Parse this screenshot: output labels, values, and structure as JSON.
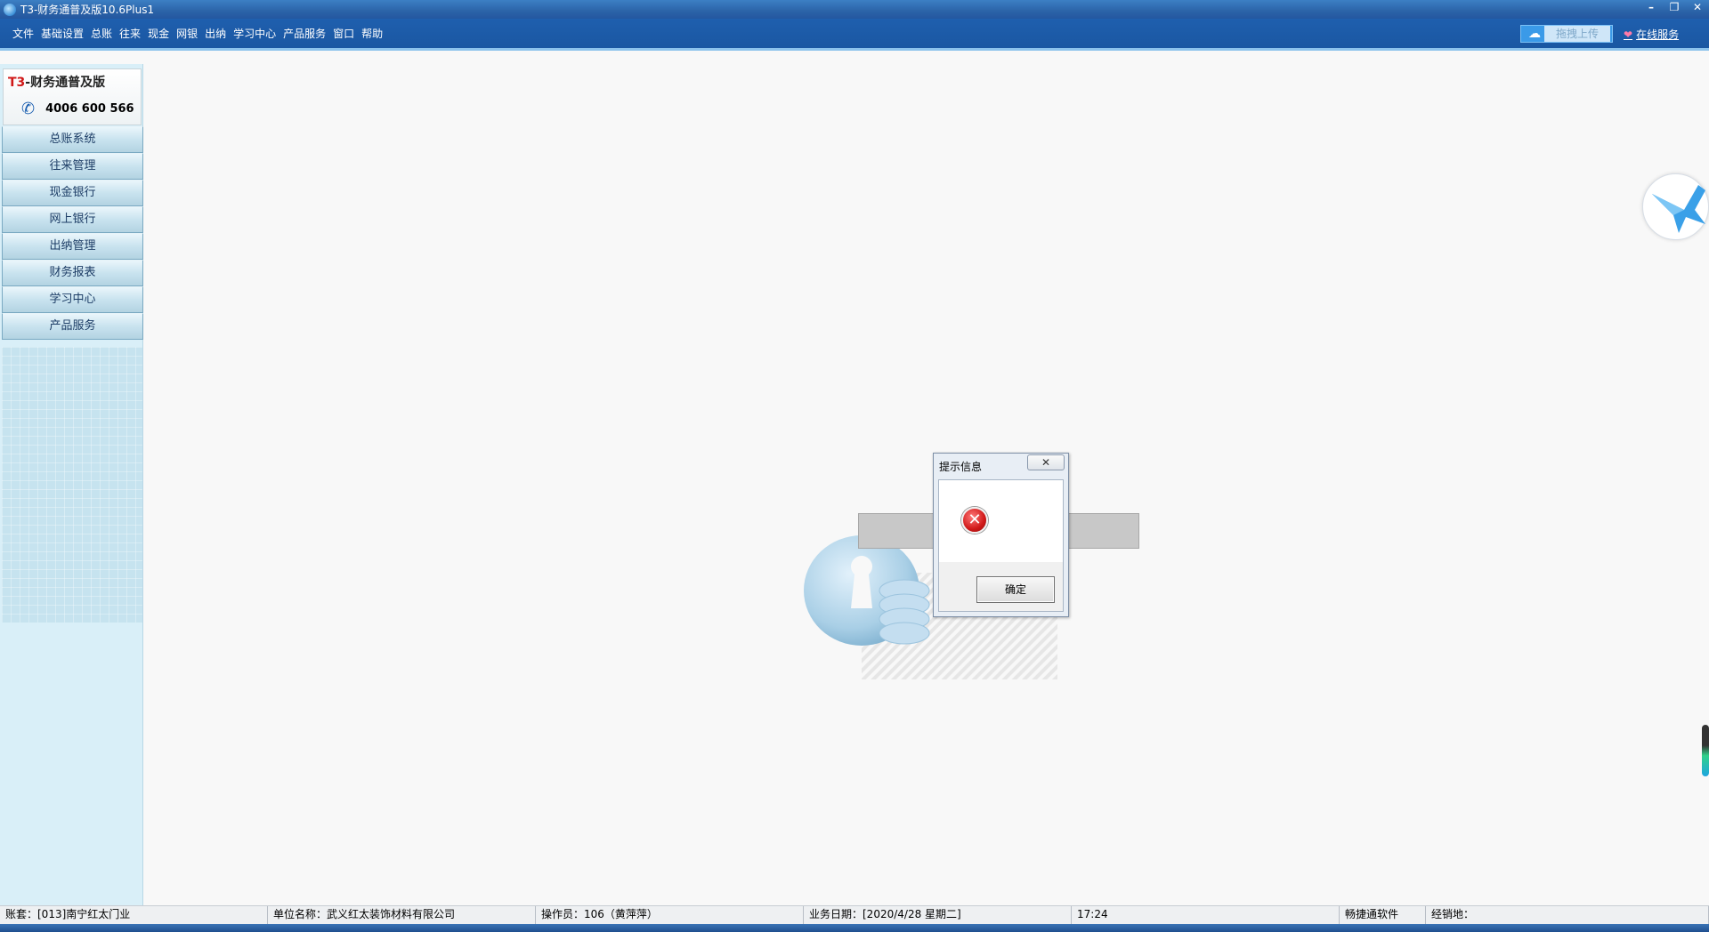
{
  "window": {
    "title": "T3-财务通普及版10.6Plus1",
    "controls": [
      "–",
      "❐",
      "✕"
    ]
  },
  "menubar": {
    "items": [
      "文件",
      "基础设置",
      "总账",
      "往来",
      "现金",
      "网银",
      "出纳",
      "学习中心",
      "产品服务",
      "窗口",
      "帮助"
    ],
    "upload_label": "拖拽上传",
    "online_service_label": "在线服务"
  },
  "sidebar": {
    "logo_prefix": "T3",
    "logo_suffix": "-财务通普及版",
    "phone": "4006 600 566",
    "nav_items": [
      "总账系统",
      "往来管理",
      "现金银行",
      "网上银行",
      "出纳管理",
      "财务报表",
      "学习中心",
      "产品服务"
    ]
  },
  "dialog": {
    "title": "提示信息",
    "ok_label": "确定"
  },
  "statusbar": {
    "account": "账套：[013]南宁红太门业",
    "company": "单位名称：武义红太装饰材料有限公司",
    "operator": "操作员：106（黄萍萍）",
    "business_date": "业务日期：[2020/4/28 星期二]",
    "time": "17:24",
    "vendor": "畅捷通软件",
    "dealer": "经销地："
  },
  "colors": {
    "titlebar": "#2b63a8",
    "menubar": "#1a57a2",
    "sidebar": "#d9eff8",
    "error": "#d01818"
  }
}
